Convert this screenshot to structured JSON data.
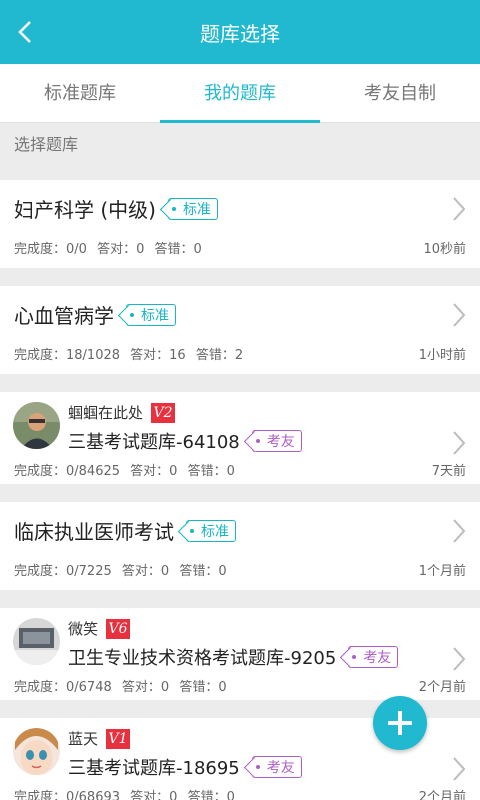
{
  "header": {
    "title": "题库选择"
  },
  "tabs": [
    {
      "label": "标准题库"
    },
    {
      "label": "我的题库"
    },
    {
      "label": "考友自制"
    }
  ],
  "active_tab": 1,
  "section_label": "选择题库",
  "items": [
    {
      "kind": "standard",
      "title": "妇产科学 (中级)",
      "tag": "标准",
      "progress": "完成度：0/0",
      "correct": "答对：0",
      "wrong": "答错：0",
      "time": "10秒前"
    },
    {
      "kind": "standard",
      "title": "心血管病学",
      "tag": "标准",
      "progress": "完成度：18/1028",
      "correct": "答对：16",
      "wrong": "答错：2",
      "time": "1小时前"
    },
    {
      "kind": "user",
      "user": "蝈蝈在此处",
      "level": "V2",
      "title": "三基考试题库-64108",
      "tag": "考友",
      "progress": "完成度：0/84625",
      "correct": "答对：0",
      "wrong": "答错：0",
      "time": "7天前"
    },
    {
      "kind": "standard",
      "title": "临床执业医师考试",
      "tag": "标准",
      "progress": "完成度：0/7225",
      "correct": "答对：0",
      "wrong": "答错：0",
      "time": "1个月前"
    },
    {
      "kind": "user",
      "user": "微笑",
      "level": "V6",
      "title": "卫生专业技术资格考试题库-9205",
      "tag": "考友",
      "progress": "完成度：0/6748",
      "correct": "答对：0",
      "wrong": "答错：0",
      "time": "2个月前"
    },
    {
      "kind": "user",
      "user": "蓝天",
      "level": "V1",
      "title": "三基考试题库-18695",
      "tag": "考友",
      "progress": "完成度：0/68693",
      "correct": "答对：0",
      "wrong": "答错：0",
      "time": "2个月前"
    }
  ],
  "colors": {
    "primary": "#21b9cf",
    "tag_standard": "#17b6c7",
    "tag_friend": "#b05ec7",
    "level_badge": "#e8313f"
  }
}
